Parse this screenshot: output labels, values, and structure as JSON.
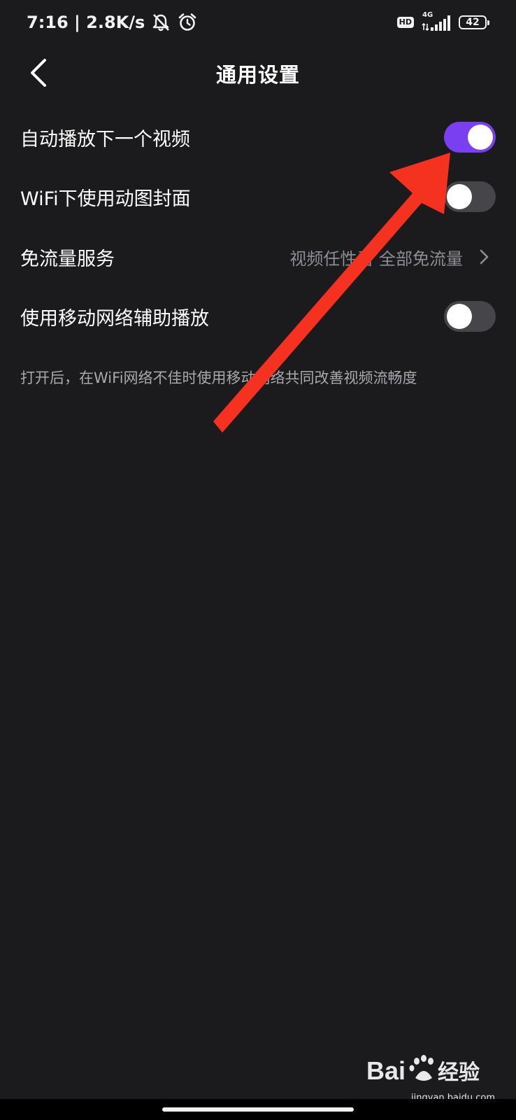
{
  "status_bar": {
    "time_speed": "7:16 | 2.8K/s",
    "hd": "HD",
    "network": "4G",
    "battery": "42"
  },
  "header": {
    "title": "通用设置"
  },
  "settings": [
    {
      "label": "自动播放下一个视频",
      "type": "toggle",
      "on": true
    },
    {
      "label": "WiFi下使用动图封面",
      "type": "toggle",
      "on": false
    },
    {
      "label": "免流量服务",
      "type": "link",
      "value": "视频任性看 全部免流量"
    },
    {
      "label": "使用移动网络辅助播放",
      "type": "toggle",
      "on": false
    }
  ],
  "hint": "打开后，在WiFi网络不佳时使用移动网络共同改善视频流畅度",
  "watermark": {
    "brand_text": "Bai经验",
    "url": "jingyan.baidu.com"
  },
  "colors": {
    "background": "#1b1b1d",
    "toggle_on": "#7b3ff2",
    "toggle_off": "#46464a",
    "annotation_arrow": "#f4321f"
  },
  "icons": {
    "mute": "bell-off-icon",
    "alarm": "alarm-clock-icon",
    "signal": "signal-icon",
    "back": "chevron-left-icon",
    "chevron": "chevron-right-icon"
  }
}
